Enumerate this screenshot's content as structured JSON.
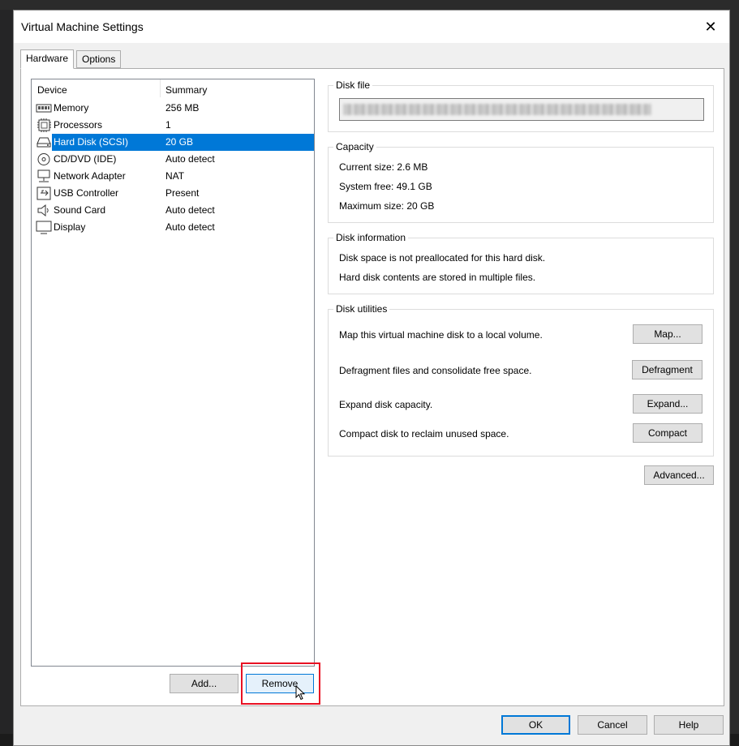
{
  "window": {
    "title": "Virtual Machine Settings",
    "close_glyph": "✕"
  },
  "tabs": [
    {
      "label": "Hardware"
    },
    {
      "label": "Options"
    }
  ],
  "device_list": {
    "headers": {
      "device": "Device",
      "summary": "Summary"
    },
    "rows": [
      {
        "name": "Memory",
        "summary": "256 MB",
        "icon": "memory-icon"
      },
      {
        "name": "Processors",
        "summary": "1",
        "icon": "processor-icon"
      },
      {
        "name": "Hard Disk (SCSI)",
        "summary": "20 GB",
        "icon": "hard-disk-icon",
        "selected": true
      },
      {
        "name": "CD/DVD (IDE)",
        "summary": "Auto detect",
        "icon": "cd-dvd-icon"
      },
      {
        "name": "Network Adapter",
        "summary": "NAT",
        "icon": "network-adapter-icon"
      },
      {
        "name": "USB Controller",
        "summary": "Present",
        "icon": "usb-icon"
      },
      {
        "name": "Sound Card",
        "summary": "Auto detect",
        "icon": "sound-card-icon"
      },
      {
        "name": "Display",
        "summary": "Auto detect",
        "icon": "display-icon"
      }
    ],
    "add_label": "Add...",
    "remove_label": "Remove"
  },
  "disk_file": {
    "label": "Disk file"
  },
  "capacity": {
    "label": "Capacity",
    "current": "Current size:  2.6 MB",
    "system_free": "System free:  49.1 GB",
    "maximum": "Maximum size:  20 GB"
  },
  "disk_information": {
    "label": "Disk information",
    "line1": "Disk space is not preallocated for this hard disk.",
    "line2": "Hard disk contents are stored in multiple files."
  },
  "disk_utilities": {
    "label": "Disk utilities",
    "items": [
      {
        "text": "Map this virtual machine disk to a local volume.",
        "button": "Map..."
      },
      {
        "text": "Defragment files and consolidate free space.",
        "button": "Defragment"
      },
      {
        "text": "Expand disk capacity.",
        "button": "Expand..."
      },
      {
        "text": "Compact disk to reclaim unused space.",
        "button": "Compact"
      }
    ]
  },
  "advanced_label": "Advanced...",
  "footer": {
    "ok": "OK",
    "cancel": "Cancel",
    "help": "Help"
  },
  "colors": {
    "selection": "#0078d7",
    "highlight": "#e81123"
  }
}
